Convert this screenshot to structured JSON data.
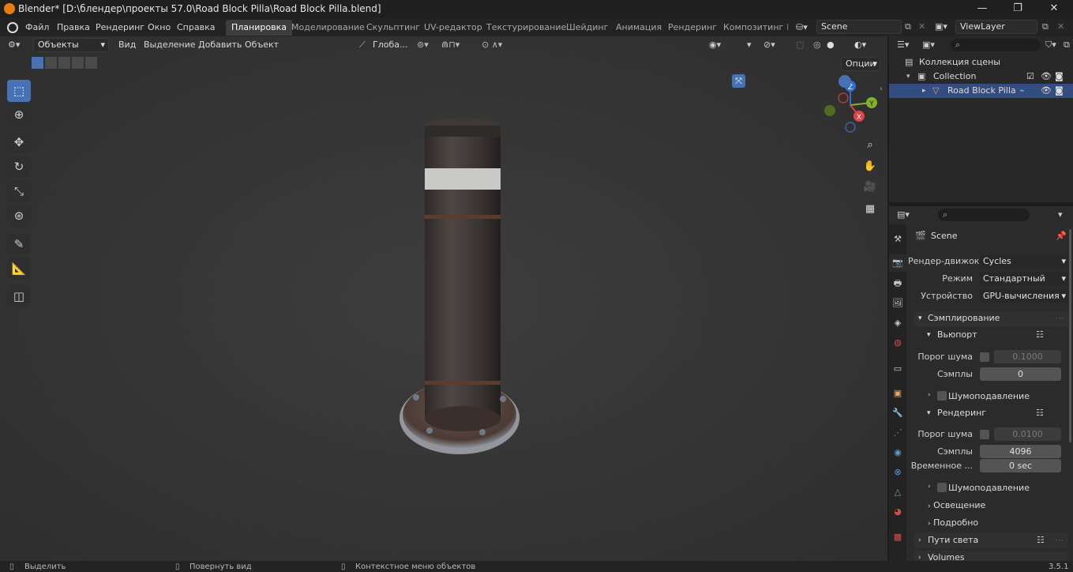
{
  "window": {
    "title": "Blender* [D:\\блендер\\проекты 57.0\\Road Block Pilla\\Road Block Pilla.blend]",
    "minimize": "—",
    "maximize": "❐",
    "close": "✕"
  },
  "menu": {
    "items": [
      "Файл",
      "Правка",
      "Рендеринг",
      "Окно",
      "Справка"
    ]
  },
  "workspaces": [
    "Планировка",
    "Моделирование",
    "Скульптинг",
    "UV-редактор",
    "Текстурирование",
    "Шейдинг",
    "Анимация",
    "Рендеринг",
    "Композитинг",
    "I"
  ],
  "active_workspace": "Планировка",
  "scene": {
    "name": "Scene"
  },
  "view_layer": {
    "name": "ViewLayer"
  },
  "viewport": {
    "mode": "Объекты",
    "menus": [
      "Вид",
      "Выделение",
      "Добавить",
      "Объект"
    ],
    "transform_orientation": "Глоба...",
    "options_label": "Опции",
    "gizmo": {
      "z": "Z",
      "y": "Y",
      "x": "X"
    }
  },
  "outliner": {
    "root": "Коллекция сцены",
    "collection": "Collection",
    "object": "Road Block Pilla"
  },
  "properties": {
    "context_name": "Scene",
    "render_engine_label": "Рендер-движок",
    "render_engine": "Cycles",
    "mode_label": "Режим",
    "mode": "Стандартный",
    "device_label": "Устройство",
    "device": "GPU-вычисления",
    "sampling": "Сэмплирование",
    "viewport": "Вьюпорт",
    "noise_threshold_label": "Порог шума",
    "viewport_noise_threshold": "0.1000",
    "samples_label": "Сэмплы",
    "viewport_samples": "0",
    "denoise": "Шумоподавление",
    "render": "Рендеринг",
    "render_noise_threshold": "0.0100",
    "render_samples": "4096",
    "time_limit_label": "Временное ...",
    "time_limit": "0 sec",
    "render_denoise": "Шумоподавление",
    "lighting": "Освещение",
    "advanced": "Подробно",
    "light_paths": "Пути света",
    "volumes": "Volumes"
  },
  "status": {
    "select": "Выделить",
    "rotate": "Повернуть вид",
    "context": "Контекстное меню объектов",
    "version": "3.5.1"
  }
}
